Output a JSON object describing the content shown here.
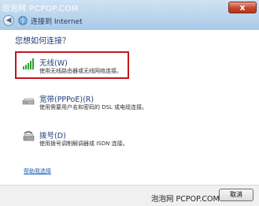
{
  "watermark_top": "泡泡网 PCPOP.COM",
  "watermark_bottom": "泡泡网 PCPOP.COM",
  "window": {
    "nav_title": "连接到 Internet",
    "close_symbol": "x",
    "back_symbol": "◀"
  },
  "main": {
    "question": "您想如何连接？",
    "options": [
      {
        "title": "无线(W)",
        "description": "使用无线路由器或无线网络连接。",
        "icon": "wireless-signal-icon"
      },
      {
        "title": "宽带(PPPoE)(R)",
        "description": "使用需要用户名和密码的 DSL 或电缆连接。",
        "icon": "broadband-modem-icon"
      },
      {
        "title": "拨号(D)",
        "description": "使用拨号调制解调器或 ISDN 连接。",
        "icon": "dialup-modem-icon"
      }
    ],
    "help_link": "帮助我选择"
  },
  "footer": {
    "cancel_label": "取消"
  },
  "colors": {
    "title_text": "#1f3f7a",
    "highlight_border": "#c4161c",
    "link": "#1a5fb4"
  }
}
